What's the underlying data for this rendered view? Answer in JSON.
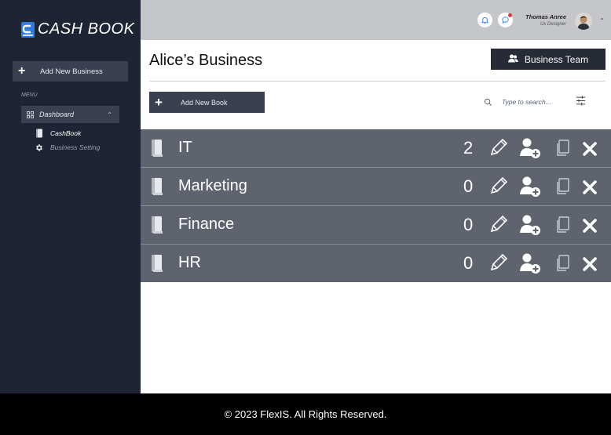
{
  "app": {
    "logo_text": "CASH BOOK"
  },
  "sidebar": {
    "add_business_label": "Add New Business",
    "menu_title": "MENU",
    "dashboard_label": "Dashboard",
    "items": [
      {
        "label": "CashBook",
        "icon": "book-icon"
      },
      {
        "label": "Business Setting",
        "icon": "gear-icon"
      }
    ]
  },
  "topbar": {
    "user_name": "Thomas Anree",
    "user_role": "Ux Designer",
    "notification_dot_color": "#e03a3a"
  },
  "main": {
    "title": "Alice’s Business",
    "team_button_label": "Business Team",
    "add_book_label": "Add New Book",
    "search_placeholder": "Type to search...",
    "books": [
      {
        "name": "IT",
        "count": "2"
      },
      {
        "name": "Marketing",
        "count": "0"
      },
      {
        "name": "Finance",
        "count": "0"
      },
      {
        "name": "HR",
        "count": "0"
      }
    ]
  },
  "footer": {
    "text": "© 2023 FlexIS. All Rights Reserved."
  },
  "colors": {
    "sidebar": "#1e2433",
    "topbar": "#c4c6ca",
    "row": "#5e636e",
    "button": "#3a4050",
    "accent": "#2f7de1"
  }
}
